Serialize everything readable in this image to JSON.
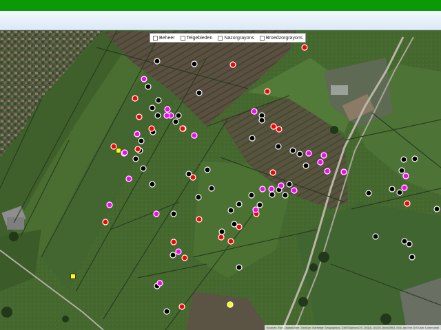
{
  "legend": {
    "items": [
      {
        "label": "Beheer"
      },
      {
        "label": "Telgebieden"
      },
      {
        "label": "Nazorgrayons"
      },
      {
        "label": "Broedzorgrayons"
      }
    ]
  },
  "attribution": "Sources: Esri, DigitalGlobe, GeoEye, Earthstar Geographics, CNES/Airbus DS, USDA, USGS, AeroGRID, IGN, and the GIS User Community",
  "marker_colors": {
    "black": "#000000",
    "red": "#ff0000",
    "magenta": "#ff00ff",
    "yellow": "#ffff00",
    "stroke": "#ffffff"
  },
  "markers": {
    "black": [
      [
        228,
        89
      ],
      [
        282,
        93
      ],
      [
        289,
        135
      ],
      [
        215,
        126
      ],
      [
        230,
        146
      ],
      [
        221,
        157
      ],
      [
        229,
        168
      ],
      [
        259,
        168
      ],
      [
        255,
        177
      ],
      [
        266,
        187
      ],
      [
        222,
        192
      ],
      [
        205,
        205
      ],
      [
        203,
        219
      ],
      [
        180,
        223
      ],
      [
        197,
        231
      ],
      [
        208,
        245
      ],
      [
        221,
        268
      ],
      [
        274,
        253
      ],
      [
        301,
        247
      ],
      [
        307,
        274
      ],
      [
        288,
        287
      ],
      [
        252,
        311
      ],
      [
        335,
        306
      ],
      [
        347,
        297
      ],
      [
        377,
        298
      ],
      [
        365,
        284
      ],
      [
        380,
        168
      ],
      [
        380,
        175
      ],
      [
        366,
        201
      ],
      [
        404,
        213
      ],
      [
        425,
        219
      ],
      [
        435,
        224
      ],
      [
        444,
        241
      ],
      [
        420,
        268
      ],
      [
        405,
        276
      ],
      [
        395,
        283
      ],
      [
        414,
        284
      ],
      [
        322,
        337
      ],
      [
        340,
        326
      ],
      [
        251,
        371
      ],
      [
        347,
        389
      ],
      [
        228,
        416
      ],
      [
        242,
        453
      ],
      [
        535,
        281
      ],
      [
        569,
        275
      ],
      [
        580,
        280
      ],
      [
        586,
        232
      ],
      [
        602,
        231
      ],
      [
        583,
        248
      ],
      [
        545,
        344
      ],
      [
        587,
        351
      ],
      [
        594,
        355
      ],
      [
        598,
        374
      ],
      [
        634,
        304
      ]
    ],
    "red": [
      [
        442,
        69
      ],
      [
        338,
        94
      ],
      [
        388,
        133
      ],
      [
        196,
        143
      ],
      [
        202,
        170
      ],
      [
        220,
        187
      ],
      [
        265,
        187
      ],
      [
        397,
        184
      ],
      [
        405,
        188
      ],
      [
        165,
        213
      ],
      [
        200,
        217
      ],
      [
        280,
        258
      ],
      [
        396,
        251
      ],
      [
        372,
        311
      ],
      [
        289,
        319
      ],
      [
        347,
        330
      ],
      [
        153,
        323
      ],
      [
        321,
        345
      ],
      [
        335,
        351
      ],
      [
        252,
        352
      ],
      [
        268,
        375
      ],
      [
        264,
        446
      ],
      [
        591,
        296
      ]
    ],
    "magenta": [
      [
        209,
        115
      ],
      [
        243,
        159
      ],
      [
        248,
        168
      ],
      [
        242,
        168
      ],
      [
        369,
        162
      ],
      [
        282,
        197
      ],
      [
        199,
        195
      ],
      [
        448,
        223
      ],
      [
        470,
        226
      ],
      [
        465,
        236
      ],
      [
        475,
        249
      ],
      [
        499,
        250
      ],
      [
        187,
        260
      ],
      [
        381,
        275
      ],
      [
        394,
        275
      ],
      [
        408,
        270
      ],
      [
        427,
        277
      ],
      [
        371,
        305
      ],
      [
        159,
        298
      ],
      [
        227,
        311
      ],
      [
        589,
        256
      ],
      [
        587,
        273
      ],
      [
        259,
        366
      ],
      [
        232,
        412
      ],
      [
        181,
        222
      ]
    ],
    "yellow_circle": [
      [
        334,
        443
      ]
    ],
    "yellow_square": [
      [
        172,
        219
      ],
      [
        106,
        402
      ]
    ]
  }
}
